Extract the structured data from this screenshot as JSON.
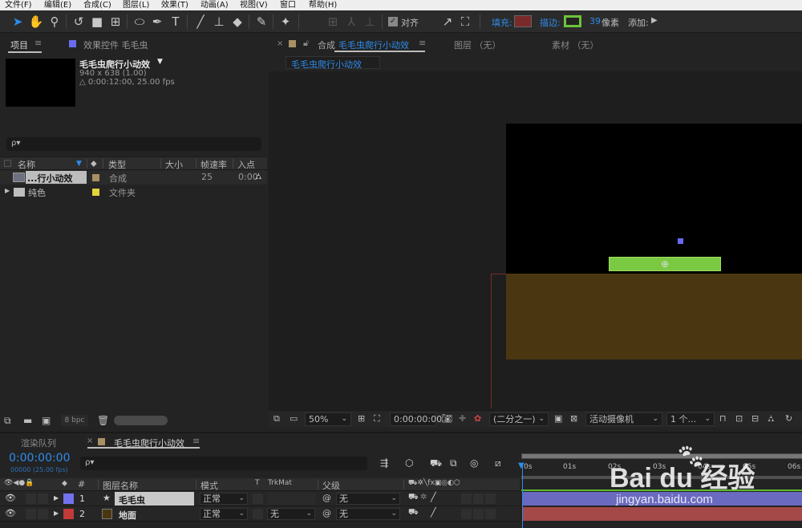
{
  "menu": [
    "文件(F)",
    "编辑(E)",
    "合成(C)",
    "图层(L)",
    "效果(T)",
    "动画(A)",
    "视图(V)",
    "窗口",
    "帮助(H)"
  ],
  "toolbar": {
    "snap_label": "对齐",
    "fill_label": "填充:",
    "stroke_label": "描边:",
    "stroke_width": "39",
    "stroke_unit": "像素",
    "add_label": "添加:",
    "fill_color": "#7a2a2a",
    "stroke_color": "#6cc43a",
    "accent": "#2d8ceb"
  },
  "project": {
    "tab_project": "项目",
    "tab_effects": "效果控件 毛毛虫",
    "comp_name": "毛毛虫爬行小动效",
    "comp_size": "940 x 638 (1.00)",
    "comp_duration": "△ 0:00:12:00, 25.00 fps",
    "search_placeholder": "ρ▾",
    "columns": {
      "name": "名称",
      "type": "类型",
      "size": "大小",
      "fps": "帧速率",
      "in": "入点"
    },
    "rows": [
      {
        "name": "...行小动效",
        "type": "合成",
        "fps": "25",
        "in": "0:00",
        "color": "#a89064"
      },
      {
        "name": "纯色",
        "type": "文件夹",
        "fps": "",
        "in": "",
        "color": "#e6d23a"
      }
    ],
    "footer_bpc": "8 bpc"
  },
  "comp": {
    "tab_label": "合成",
    "tab_name": "毛毛虫爬行小动效",
    "layer_tab": "图层 （无）",
    "footage_tab": "素材 （无）",
    "breadcrumb": "毛毛虫爬行小动效",
    "zoom": "50%",
    "timecode": "0:00:00:00",
    "resolution": "(二分之一)",
    "camera": "活动摄像机",
    "views": "1 个...",
    "bg_color": "#000000",
    "ground_color": "#4a3712",
    "caterpillar_color": "#7bc943"
  },
  "timeline": {
    "tab_render": "渲染队列",
    "tab_comp": "毛毛虫爬行小动效",
    "timecode": "0:00:00:00",
    "fps": "00000 (25.00 fps)",
    "search_placeholder": "ρ▾",
    "columns": {
      "num": "#",
      "layer_name": "图层名称",
      "mode": "模式",
      "t": "T",
      "trkmat": "TrkMat",
      "parent": "父级"
    },
    "layers": [
      {
        "num": "1",
        "name": "毛毛虫",
        "mode": "正常",
        "trkmat": "",
        "parent": "无",
        "label_color": "#7272ee"
      },
      {
        "num": "2",
        "name": "地面",
        "mode": "正常",
        "trkmat": "无",
        "parent": "无",
        "label_color": "#c23a3a"
      }
    ],
    "ruler": [
      "0s",
      "01s",
      "02s",
      "03s",
      "04s",
      "05s",
      "06s"
    ]
  },
  "watermark": {
    "logo": "Bai  du 经验",
    "url": "jingyan.baidu.com"
  }
}
